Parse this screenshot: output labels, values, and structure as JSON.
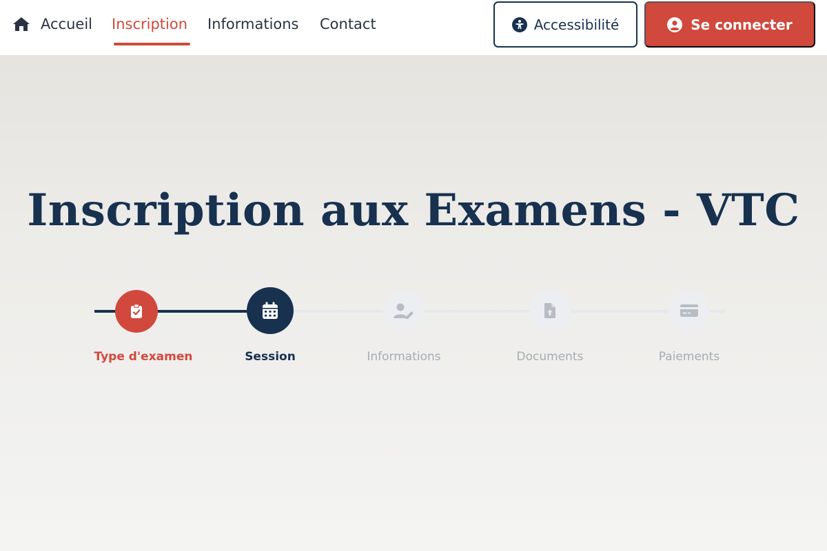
{
  "nav": {
    "home_icon": "home-icon",
    "links": [
      {
        "label": "Accueil",
        "active": false
      },
      {
        "label": "Inscription",
        "active": true
      },
      {
        "label": "Informations",
        "active": false
      },
      {
        "label": "Contact",
        "active": false
      }
    ],
    "accessibility_label": "Accessibilité",
    "accessibility_icon": "universal-access-icon",
    "login_label": "Se connecter",
    "login_icon": "user-circle-icon"
  },
  "title": "Inscription aux Examens - VTC",
  "stepper": {
    "steps": [
      {
        "label": "Type d'examen",
        "icon": "clipboard-check-icon",
        "state": "completed"
      },
      {
        "label": "Session",
        "icon": "calendar-icon",
        "state": "current"
      },
      {
        "label": "Informations",
        "icon": "user-edit-icon",
        "state": "upcoming"
      },
      {
        "label": "Documents",
        "icon": "file-upload-icon",
        "state": "upcoming"
      },
      {
        "label": "Paiements",
        "icon": "credit-card-icon",
        "state": "upcoming"
      }
    ]
  },
  "colors": {
    "brand_red": "#d1483c",
    "navy": "#17314f",
    "inactive_text": "#a7abb2",
    "inactive_circle": "#eceef1"
  }
}
